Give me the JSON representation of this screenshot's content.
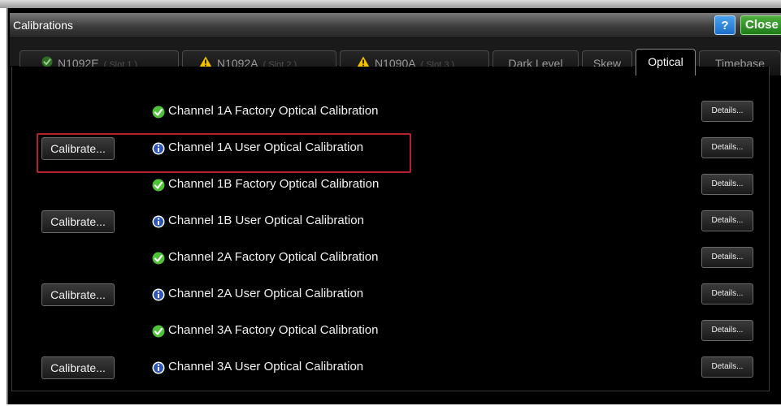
{
  "window": {
    "title": "Calibrations",
    "help_label": "?",
    "close_label": "Close"
  },
  "tabs": [
    {
      "label": "N1092E",
      "slot": "( Slot 1 )",
      "icon": "check-icon"
    },
    {
      "label": "N1092A",
      "slot": "( Slot 2 )",
      "icon": "warning-icon"
    },
    {
      "label": "N1090A",
      "slot": "( Slot 3 )",
      "icon": "warning-icon"
    },
    {
      "label": "Dark Level"
    },
    {
      "label": "Skew"
    },
    {
      "label": "Optical",
      "active": true
    },
    {
      "label": "Timebase"
    }
  ],
  "rows": [
    {
      "label": "Channel 1A Factory Optical Calibration",
      "icon": "check-icon",
      "details_label": "Details..."
    },
    {
      "label": "Channel 1A User Optical Calibration",
      "icon": "info-icon",
      "calibrate_label": "Calibrate...",
      "details_label": "Details..."
    },
    {
      "label": "Channel 1B Factory Optical Calibration",
      "icon": "check-icon",
      "details_label": "Details..."
    },
    {
      "label": "Channel 1B User Optical Calibration",
      "icon": "info-icon",
      "calibrate_label": "Calibrate...",
      "details_label": "Details..."
    },
    {
      "label": "Channel 2A Factory Optical Calibration",
      "icon": "check-icon",
      "details_label": "Details..."
    },
    {
      "label": "Channel 2A User Optical Calibration",
      "icon": "info-icon",
      "calibrate_label": "Calibrate...",
      "details_label": "Details..."
    },
    {
      "label": "Channel 3A Factory Optical Calibration",
      "icon": "check-icon",
      "details_label": "Details..."
    },
    {
      "label": "Channel 3A User Optical Calibration",
      "icon": "info-icon",
      "calibrate_label": "Calibrate...",
      "details_label": "Details..."
    }
  ],
  "colors": {
    "check_green": "#4fc23a",
    "warning_yellow": "#f2c200",
    "info_blue": "#2d56b8",
    "highlight_red": "#b3232e",
    "close_green": "#2e8f22",
    "help_blue": "#2b86dc"
  }
}
